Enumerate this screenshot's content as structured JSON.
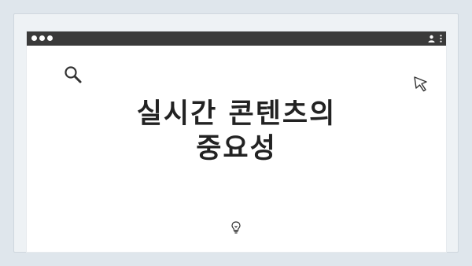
{
  "headline": {
    "line1": "실시간 콘텐츠의",
    "line2": "중요성"
  },
  "icons": {
    "titlebar_left": "window-dots-icon",
    "titlebar_right_1": "profile-icon",
    "titlebar_right_2": "kebab-menu-icon",
    "top_left": "search-icon",
    "top_right": "cursor-icon",
    "bottom_center": "lightbulb-icon"
  },
  "colors": {
    "background": "#dfe6ec",
    "titlebar": "#3a3a3a",
    "window": "#ffffff",
    "text": "#222222"
  }
}
